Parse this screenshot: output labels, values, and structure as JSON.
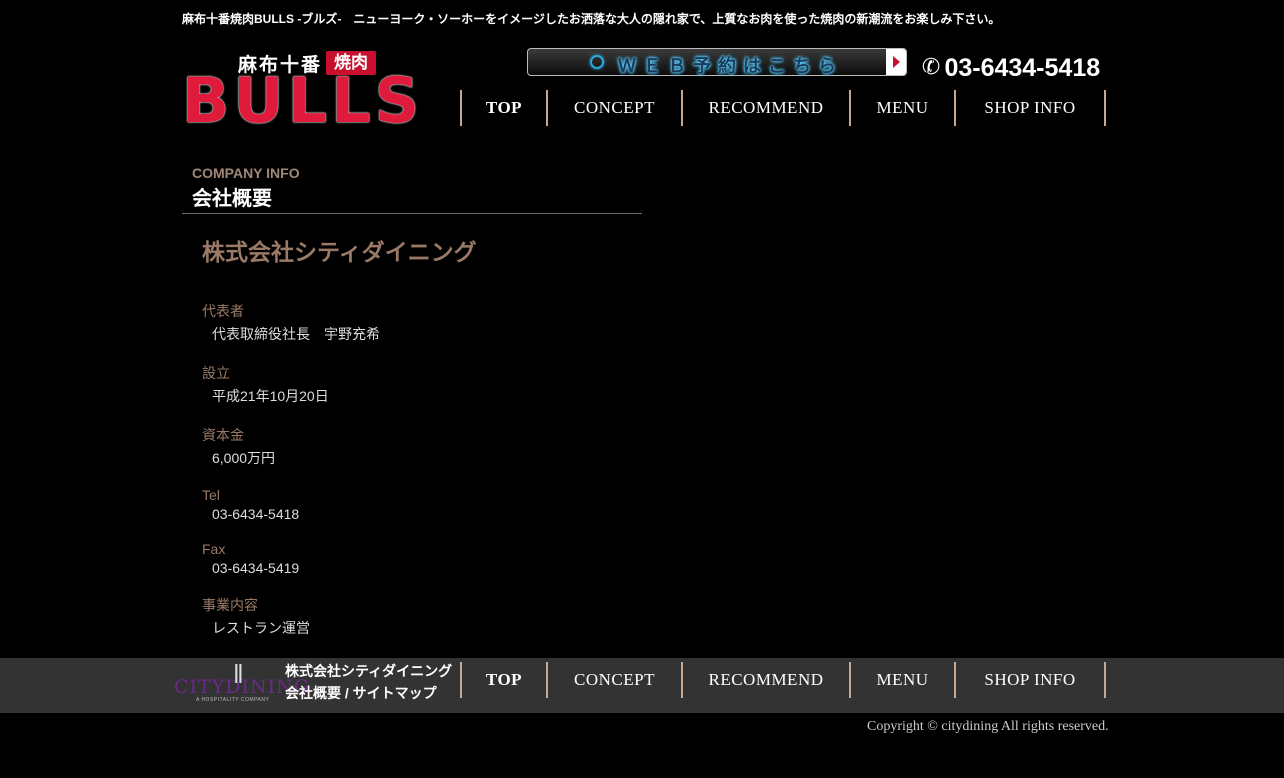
{
  "tagline": "麻布十番焼肉BULLS -ブルズ-　ニューヨーク・ソーホーをイメージしたお洒落な大人の隠れ家で、上質なお肉を使った焼肉の新潮流をお楽しみ下さい。",
  "logo": {
    "kanji": "麻布十番",
    "badge": "焼肉",
    "wordmark": "BULLS"
  },
  "reserve": {
    "label": "ＷＥＢ予約はこちら",
    "icon": "arrow-right-icon"
  },
  "phone": {
    "icon": "phone-icon",
    "number": "03-6434-5418"
  },
  "nav": {
    "items": [
      {
        "label": "TOP"
      },
      {
        "label": "CONCEPT"
      },
      {
        "label": "RECOMMEND"
      },
      {
        "label": "MENU"
      },
      {
        "label": "SHOP INFO"
      }
    ]
  },
  "section": {
    "heading_en": "COMPANY INFO",
    "heading_ja": "会社概要"
  },
  "company": {
    "name": "株式会社シティダイニング",
    "fields": [
      {
        "label": "代表者",
        "value": "代表取締役社長　宇野充希"
      },
      {
        "label": "設立",
        "value": "平成21年10月20日"
      },
      {
        "label": "資本金",
        "value": "6,000万円"
      },
      {
        "label": "Tel",
        "value": "03-6434-5418"
      },
      {
        "label": "Fax",
        "value": "03-6434-5419"
      },
      {
        "label": "事業内容",
        "value": "レストラン運営"
      }
    ]
  },
  "footer": {
    "logo_text": "CITYDINING",
    "logo_sub": "A HOSPITALITY COMPANY",
    "company": "株式会社シティダイニング",
    "link_about": "会社概要",
    "link_sep": " / ",
    "link_sitemap": "サイトマップ",
    "copyright": "Copyright © citydining All rights reserved."
  },
  "colors": {
    "accent_red": "#c8102e",
    "label_brown": "#9a7a66",
    "nav_separator": "#c8a890",
    "footer_bg": "#333333"
  }
}
